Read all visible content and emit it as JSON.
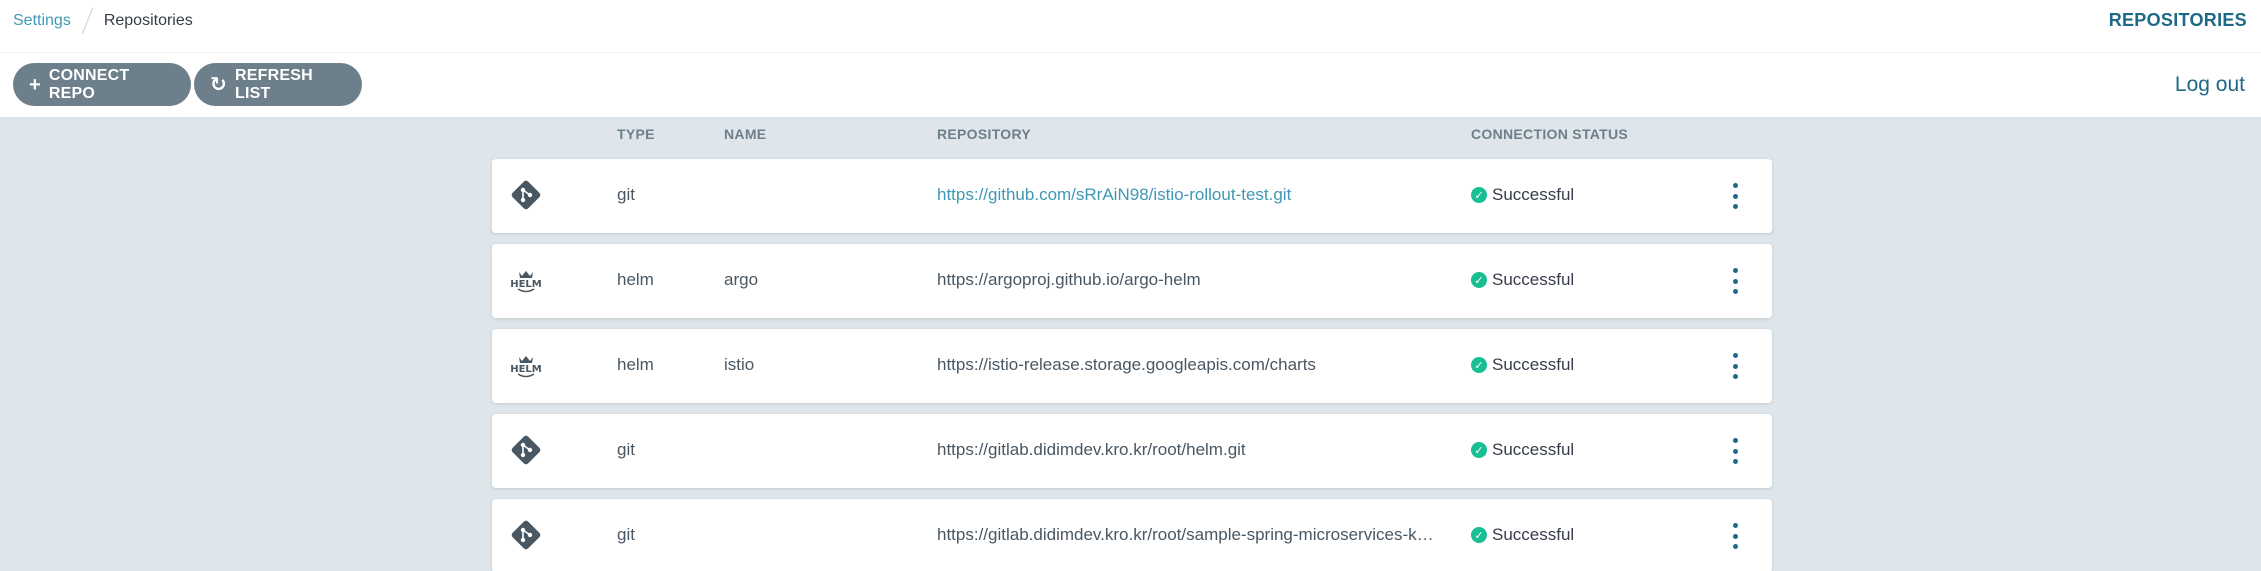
{
  "breadcrumb": {
    "parent": "Settings",
    "current": "Repositories"
  },
  "header": {
    "title": "REPOSITORIES"
  },
  "toolbar": {
    "connect_label": "CONNECT REPO",
    "connect_icon": "plus-icon",
    "refresh_label": "REFRESH LIST",
    "refresh_icon": "refresh-icon",
    "logout_label": "Log out"
  },
  "table": {
    "columns": {
      "type": "TYPE",
      "name": "NAME",
      "repository": "REPOSITORY",
      "status": "CONNECTION STATUS"
    },
    "rows": [
      {
        "icon": "git-icon",
        "type": "git",
        "name": "",
        "repository": "https://github.com/sRrAiN98/istio-rollout-test.git",
        "status": "Successful"
      },
      {
        "icon": "helm-icon",
        "type": "helm",
        "name": "argo",
        "repository": "https://argoproj.github.io/argo-helm",
        "status": "Successful"
      },
      {
        "icon": "helm-icon",
        "type": "helm",
        "name": "istio",
        "repository": "https://istio-release.storage.googleapis.com/charts",
        "status": "Successful"
      },
      {
        "icon": "git-icon",
        "type": "git",
        "name": "",
        "repository": "https://gitlab.didimdev.kro.kr/root/helm.git",
        "status": "Successful"
      },
      {
        "icon": "git-icon",
        "type": "git",
        "name": "",
        "repository": "https://gitlab.didimdev.kro.kr/root/sample-spring-microservices-ku...",
        "status": "Successful"
      }
    ]
  },
  "colors": {
    "accent": "#1e6987",
    "link": "#3f98b5",
    "success": "#18be94",
    "button": "#6d7f8b",
    "background": "#dee6eb"
  }
}
